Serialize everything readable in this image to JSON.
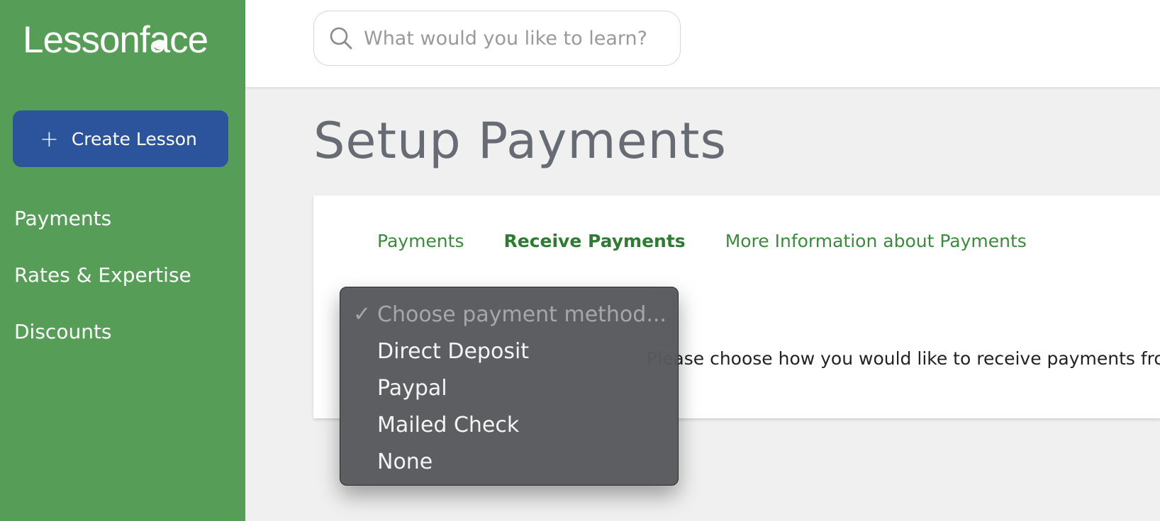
{
  "logo": {
    "text_before": "Lessonf",
    "text_face": "a",
    "text_after": "ce"
  },
  "sidebar": {
    "create_label": "Create Lesson",
    "items": [
      {
        "label": "Payments"
      },
      {
        "label": "Rates & Expertise"
      },
      {
        "label": "Discounts"
      }
    ]
  },
  "search": {
    "placeholder": "What would you like to learn?"
  },
  "page": {
    "title": "Setup Payments"
  },
  "tabs": [
    {
      "label": "Payments",
      "active": false
    },
    {
      "label": "Receive Payments",
      "active": true
    },
    {
      "label": "More Information about Payments",
      "active": false
    }
  ],
  "help_text": "Please choose how you would like to receive payments from Lessonface.",
  "dropdown": {
    "check_glyph": "✓",
    "options": [
      {
        "label": "Choose payment method...",
        "selected": true,
        "disabled": true
      },
      {
        "label": "Direct Deposit"
      },
      {
        "label": "Paypal"
      },
      {
        "label": "Mailed Check"
      },
      {
        "label": "None"
      }
    ]
  },
  "colors": {
    "sidebar": "#569e57",
    "create_button": "#2b549c",
    "tab_text": "#3b8a3e",
    "dropdown_bg": "#58595d"
  }
}
